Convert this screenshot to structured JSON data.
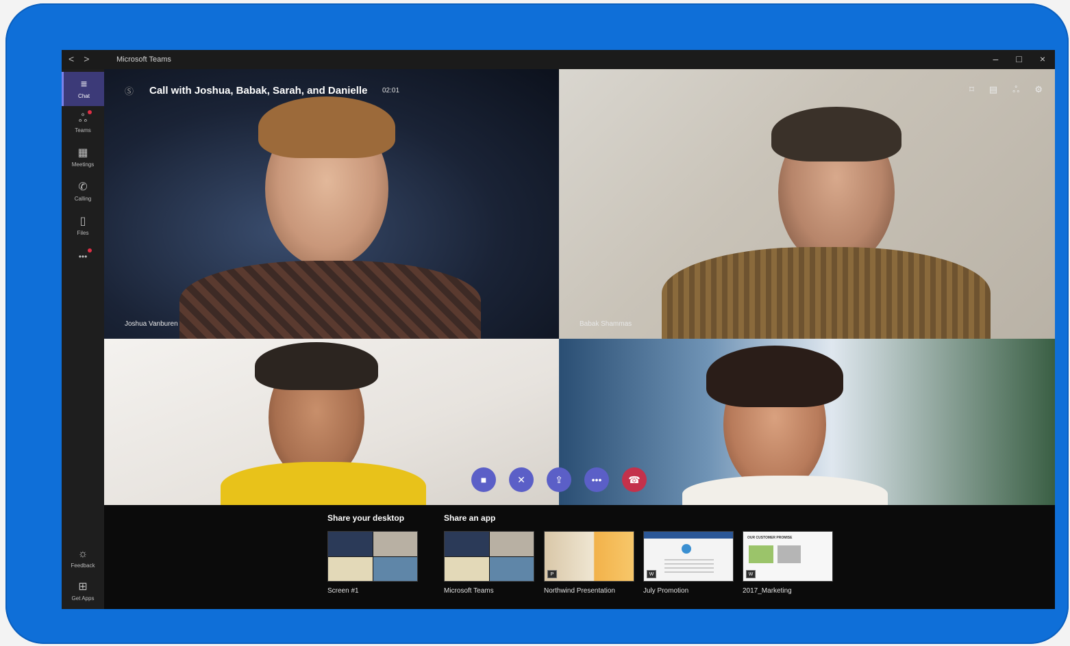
{
  "window": {
    "title": "Microsoft Teams",
    "nav_back": "<",
    "nav_forward": ">",
    "minimize": "–",
    "maximize": "□",
    "close": "×"
  },
  "rail": {
    "items": [
      {
        "label": "Chat",
        "icon": "chat-icon",
        "glyph": "≡"
      },
      {
        "label": "Teams",
        "icon": "teams-icon",
        "glyph": "ஃ"
      },
      {
        "label": "Meetings",
        "icon": "calendar-icon",
        "glyph": "▦"
      },
      {
        "label": "Calling",
        "icon": "phone-icon",
        "glyph": "✆"
      },
      {
        "label": "Files",
        "icon": "file-icon",
        "glyph": "▯"
      },
      {
        "label": "",
        "icon": "more-icon",
        "glyph": "•••"
      }
    ],
    "bottom": [
      {
        "label": "Feedback",
        "icon": "lightbulb-icon",
        "glyph": "☼"
      },
      {
        "label": "Get Apps",
        "icon": "apps-icon",
        "glyph": "⊞"
      }
    ]
  },
  "call": {
    "title": "Call with Joshua, Babak, Sarah, and Danielle",
    "timer": "02:01",
    "icon_glyph": "Ⓢ"
  },
  "participants": [
    {
      "name": "Joshua Vanburen"
    },
    {
      "name": "Babak Shammas"
    },
    {
      "name": ""
    },
    {
      "name": ""
    }
  ],
  "top_right_icons": [
    "⌑",
    "▤",
    "ஃ",
    "⚙"
  ],
  "controls": [
    {
      "name": "camera",
      "glyph": "■"
    },
    {
      "name": "mute",
      "glyph": "✕"
    },
    {
      "name": "share",
      "glyph": "⇪"
    },
    {
      "name": "more",
      "glyph": "•••"
    },
    {
      "name": "hangup",
      "glyph": "☎"
    }
  ],
  "share": {
    "desktop_heading": "Share your desktop",
    "app_heading": "Share an app",
    "items": [
      {
        "label": "Screen #1",
        "type": "screen"
      },
      {
        "label": "Microsoft Teams",
        "type": "teams"
      },
      {
        "label": "Northwind Presentation",
        "type": "ppt",
        "badge": "P"
      },
      {
        "label": "July Promotion",
        "type": "word",
        "badge": "W"
      },
      {
        "label": "2017_Marketing",
        "type": "word2",
        "badge": "W",
        "inner_text": "OUR CUSTOMER PROMISE"
      }
    ]
  }
}
